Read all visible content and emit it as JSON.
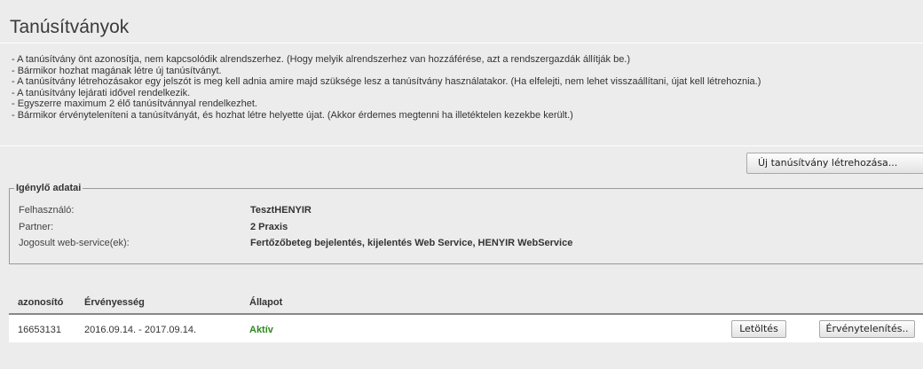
{
  "page": {
    "title": "Tanúsítványok"
  },
  "info_lines": [
    "- A tanúsítvány önt azonosítja, nem kapcsolódik alrendszerhez. (Hogy melyik alrendszerhez van hozzáférése, azt a rendszergazdák állítják be.)",
    "- Bármikor hozhat magának létre új tanúsítványt.",
    "- A tanúsítvány létrehozásakor egy jelszót is meg kell adnia amire majd szüksége lesz a tanúsítvány használatakor. (Ha elfelejti, nem lehet visszaállítani, újat kell létrehoznia.)",
    "- A tanúsítvány lejárati idővel rendelkezik.",
    "- Egyszerre maximum 2 élő tanúsítvánnyal rendelkezhet.",
    "- Bármikor érvényteleníteni a tanúsítványát, és hozhat létre helyette újat. (Akkor érdemes megtenni ha illetéktelen kezekbe került.)"
  ],
  "new_cert_button": "Új tanúsítvány létrehozása...",
  "requester": {
    "legend": "Igénylő adatai",
    "fields": [
      {
        "label": "Felhasználó:",
        "value": "TesztHENYIR"
      },
      {
        "label": "Partner:",
        "value": "2 Praxis"
      },
      {
        "label": "Jogosult web-service(ek):",
        "value": "Fertőzőbeteg bejelentés, kijelentés Web Service, HENYIR WebService"
      }
    ]
  },
  "table": {
    "headers": [
      "azonosító",
      "Érvényesség",
      "Állapot"
    ],
    "rows": [
      {
        "id": "16653131",
        "validity": "2016.09.14. - 2017.09.14.",
        "status": "Aktív",
        "download_label": "Letöltés",
        "revoke_label": "Érvénytelenítés.."
      }
    ]
  },
  "colors": {
    "background": "#ececec",
    "active_status": "#2a8a1a"
  }
}
